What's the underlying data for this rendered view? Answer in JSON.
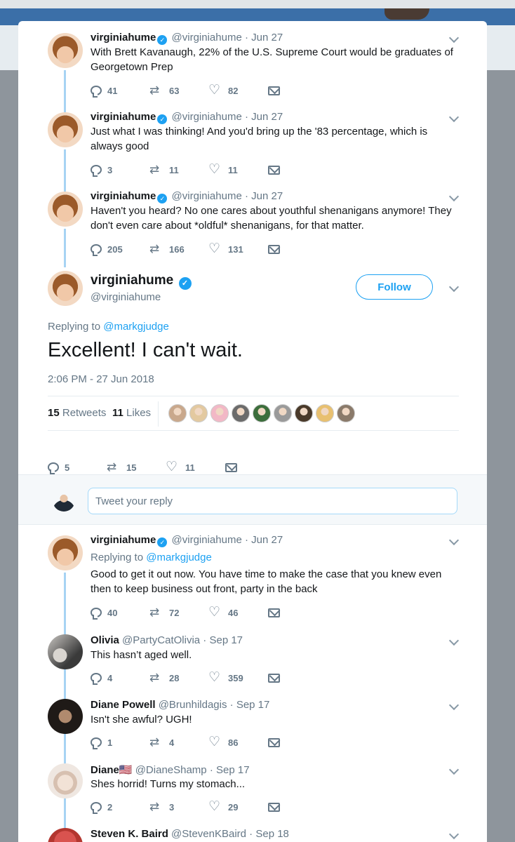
{
  "thread": [
    {
      "name": "virginiahume",
      "handle": "@virginiahume",
      "date": "Jun 27",
      "text": "With Brett Kavanaugh, 22% of the U.S. Supreme Court would be graduates of Georgetown Prep",
      "replies": "41",
      "retweets": "63",
      "likes": "82"
    },
    {
      "name": "virginiahume",
      "handle": "@virginiahume",
      "date": "Jun 27",
      "text": "Just what I was thinking! And you'd bring up the '83 percentage, which is always good",
      "replies": "3",
      "retweets": "11",
      "likes": "11"
    },
    {
      "name": "virginiahume",
      "handle": "@virginiahume",
      "date": "Jun 27",
      "text": "Haven't you heard?  No one cares about youthful shenanigans anymore! They don't even care about *oldful* shenanigans, for that matter.",
      "replies": "205",
      "retweets": "166",
      "likes": "131"
    }
  ],
  "main_tweet": {
    "name": "virginiahume",
    "handle": "@virginiahume",
    "follow_label": "Follow",
    "replying_prefix": "Replying to",
    "replying_to": "@markgjudge",
    "text": "Excellent! I can't wait.",
    "timestamp": "2:06 PM - 27 Jun 2018",
    "retweet_count": "15",
    "retweet_label": "Retweets",
    "like_count": "11",
    "like_label": "Likes",
    "replies": "5",
    "retweets": "15",
    "likes": "11"
  },
  "liker_colors": [
    "#c9a88c",
    "#e3c9a0",
    "#f2b8c6",
    "#6b6b6b",
    "#3c6e3c",
    "#9a9a9a",
    "#4a3a2a",
    "#e8c070",
    "#8a7a6a"
  ],
  "reply_box": {
    "placeholder": "Tweet your reply"
  },
  "replies": [
    {
      "name": "virginiahume",
      "handle": "@virginiahume",
      "date": "Jun 27",
      "replying_prefix": "Replying to",
      "replying_to": "@markgjudge",
      "text": "Good to get it out now. You have time to make the case that you knew even then to keep business out front, party in the back",
      "replies": "40",
      "retweets": "72",
      "likes": "46"
    },
    {
      "name": "Olivia",
      "handle": "@PartyCatOlivia",
      "date": "Sep 17",
      "text": "This hasn’t aged well.",
      "replies": "4",
      "retweets": "28",
      "likes": "359"
    },
    {
      "name": "Diane Powell",
      "handle": "@Brunhildagis",
      "date": "Sep 17",
      "text": "Isn't she awful? UGH!",
      "replies": "1",
      "retweets": "4",
      "likes": "86"
    },
    {
      "name": "Diane🇺🇸",
      "handle": "@DianeShamp",
      "date": "Sep 17",
      "text": "Shes horrid! Turns my stomach...",
      "replies": "2",
      "retweets": "3",
      "likes": "29"
    },
    {
      "name": "Steven K. Baird",
      "handle": "@StevenKBaird",
      "date": "Sep 18"
    }
  ],
  "colors": {
    "accent": "#1da1f2",
    "thread_line": "#a7d3f3",
    "muted": "#657786"
  }
}
